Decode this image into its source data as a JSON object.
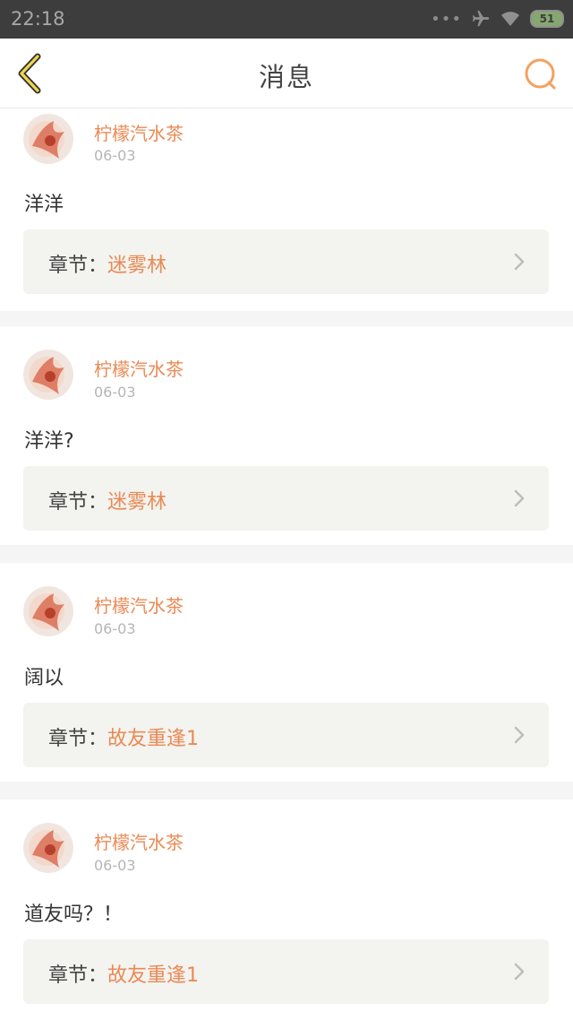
{
  "status_bar": {
    "time": "22:18",
    "dots": "•••",
    "battery": "51"
  },
  "header": {
    "title": "消息",
    "back_icon": "chevron-left-icon",
    "search_icon": "search-icon",
    "accent_color": "#f2a261"
  },
  "messages": [
    {
      "user": "柠檬汽水茶",
      "date": "06-03",
      "content": "洋洋",
      "chapter_label": "章节：",
      "chapter_name": "迷雾林"
    },
    {
      "user": "柠檬汽水茶",
      "date": "06-03",
      "content": "洋洋?",
      "chapter_label": "章节：",
      "chapter_name": "迷雾林"
    },
    {
      "user": "柠檬汽水茶",
      "date": "06-03",
      "content": "阔以",
      "chapter_label": "章节：",
      "chapter_name": "故友重逢1"
    },
    {
      "user": "柠檬汽水茶",
      "date": "06-03",
      "content": "道友吗？！",
      "chapter_label": "章节：",
      "chapter_name": "故友重逢1"
    }
  ]
}
